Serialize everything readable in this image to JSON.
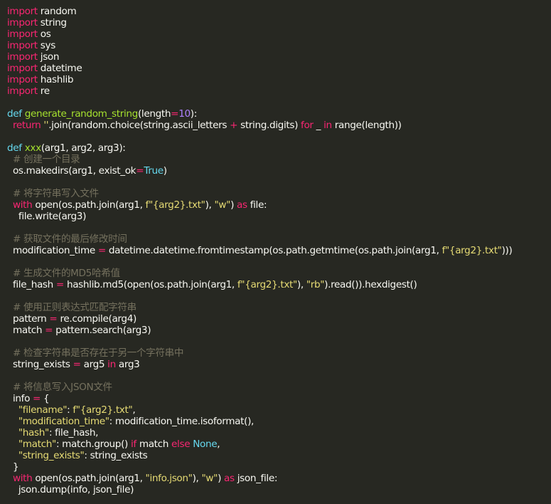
{
  "colors": {
    "background": "#272822",
    "text": "#f8f8f2",
    "keyword": "#f92672",
    "function": "#a6e22e",
    "number": "#ae81ff",
    "string": "#e6db74",
    "builtin": "#66d9ef",
    "comment": "#75715e"
  },
  "code_lines": [
    [
      [
        "kw",
        "import"
      ],
      [
        "pl",
        " random"
      ]
    ],
    [
      [
        "kw",
        "import"
      ],
      [
        "pl",
        " string"
      ]
    ],
    [
      [
        "kw",
        "import"
      ],
      [
        "pl",
        " os"
      ]
    ],
    [
      [
        "kw",
        "import"
      ],
      [
        "pl",
        " sys"
      ]
    ],
    [
      [
        "kw",
        "import"
      ],
      [
        "pl",
        " json"
      ]
    ],
    [
      [
        "kw",
        "import"
      ],
      [
        "pl",
        " datetime"
      ]
    ],
    [
      [
        "kw",
        "import"
      ],
      [
        "pl",
        " hashlib"
      ]
    ],
    [
      [
        "kw",
        "import"
      ],
      [
        "pl",
        " re"
      ]
    ],
    [],
    [
      [
        "bi",
        "def"
      ],
      [
        "pl",
        " "
      ],
      [
        "fn",
        "generate_random_string"
      ],
      [
        "pl",
        "(length"
      ],
      [
        "op",
        "="
      ],
      [
        "num",
        "10"
      ],
      [
        "pl",
        "):"
      ]
    ],
    [
      [
        "pl",
        "  "
      ],
      [
        "kw",
        "return"
      ],
      [
        "pl",
        " "
      ],
      [
        "str",
        "''"
      ],
      [
        "pl",
        ".join(random.choice(string.ascii_letters "
      ],
      [
        "op",
        "+"
      ],
      [
        "pl",
        " string.digits) "
      ],
      [
        "kw",
        "for"
      ],
      [
        "pl",
        " _ "
      ],
      [
        "kw",
        "in"
      ],
      [
        "pl",
        " range(length))"
      ]
    ],
    [],
    [
      [
        "bi",
        "def"
      ],
      [
        "pl",
        " "
      ],
      [
        "fn",
        "xxx"
      ],
      [
        "pl",
        "(arg1, arg2, arg3):"
      ]
    ],
    [
      [
        "pl",
        "  "
      ],
      [
        "cm",
        "# 创建一个目录"
      ]
    ],
    [
      [
        "pl",
        "  os.makedirs(arg1, exist_ok"
      ],
      [
        "op",
        "="
      ],
      [
        "bi",
        "True"
      ],
      [
        "pl",
        ")"
      ]
    ],
    [],
    [
      [
        "pl",
        "  "
      ],
      [
        "cm",
        "# 将字符串写入文件"
      ]
    ],
    [
      [
        "pl",
        "  "
      ],
      [
        "kw",
        "with"
      ],
      [
        "pl",
        " open(os.path.join(arg1, "
      ],
      [
        "str",
        "f\"{arg2}.txt\""
      ],
      [
        "pl",
        "), "
      ],
      [
        "str",
        "\"w\""
      ],
      [
        "pl",
        ") "
      ],
      [
        "kw",
        "as"
      ],
      [
        "pl",
        " file:"
      ]
    ],
    [
      [
        "pl",
        "    file.write(arg3)"
      ]
    ],
    [],
    [
      [
        "pl",
        "  "
      ],
      [
        "cm",
        "# 获取文件的最后修改时间"
      ]
    ],
    [
      [
        "pl",
        "  modification_time "
      ],
      [
        "op",
        "="
      ],
      [
        "pl",
        " datetime.datetime.fromtimestamp(os.path.getmtime(os.path.join(arg1, "
      ],
      [
        "str",
        "f\"{arg2}.txt\""
      ],
      [
        "pl",
        ")))"
      ]
    ],
    [],
    [
      [
        "pl",
        "  "
      ],
      [
        "cm",
        "# 生成文件的MD5哈希值"
      ]
    ],
    [
      [
        "pl",
        "  file_hash "
      ],
      [
        "op",
        "="
      ],
      [
        "pl",
        " hashlib.md5(open(os.path.join(arg1, "
      ],
      [
        "str",
        "f\"{arg2}.txt\""
      ],
      [
        "pl",
        "), "
      ],
      [
        "str",
        "\"rb\""
      ],
      [
        "pl",
        ").read()).hexdigest()"
      ]
    ],
    [],
    [
      [
        "pl",
        "  "
      ],
      [
        "cm",
        "# 使用正则表达式匹配字符串"
      ]
    ],
    [
      [
        "pl",
        "  pattern "
      ],
      [
        "op",
        "="
      ],
      [
        "pl",
        " re.compile(arg4)"
      ]
    ],
    [
      [
        "pl",
        "  match "
      ],
      [
        "op",
        "="
      ],
      [
        "pl",
        " pattern.search(arg3)"
      ]
    ],
    [],
    [
      [
        "pl",
        "  "
      ],
      [
        "cm",
        "# 检查字符串是否存在于另一个字符串中"
      ]
    ],
    [
      [
        "pl",
        "  string_exists "
      ],
      [
        "op",
        "="
      ],
      [
        "pl",
        " arg5 "
      ],
      [
        "kw",
        "in"
      ],
      [
        "pl",
        " arg3"
      ]
    ],
    [],
    [
      [
        "pl",
        "  "
      ],
      [
        "cm",
        "# 将信息写入JSON文件"
      ]
    ],
    [
      [
        "pl",
        "  info "
      ],
      [
        "op",
        "="
      ],
      [
        "pl",
        " {"
      ]
    ],
    [
      [
        "pl",
        "    "
      ],
      [
        "str",
        "\"filename\""
      ],
      [
        "pl",
        ": "
      ],
      [
        "str",
        "f\"{arg2}.txt\""
      ],
      [
        "pl",
        ","
      ]
    ],
    [
      [
        "pl",
        "    "
      ],
      [
        "str",
        "\"modification_time\""
      ],
      [
        "pl",
        ": modification_time.isoformat(),"
      ]
    ],
    [
      [
        "pl",
        "    "
      ],
      [
        "str",
        "\"hash\""
      ],
      [
        "pl",
        ": file_hash,"
      ]
    ],
    [
      [
        "pl",
        "    "
      ],
      [
        "str",
        "\"match\""
      ],
      [
        "pl",
        ": match.group() "
      ],
      [
        "kw",
        "if"
      ],
      [
        "pl",
        " match "
      ],
      [
        "kw",
        "else"
      ],
      [
        "pl",
        " "
      ],
      [
        "bi",
        "None"
      ],
      [
        "pl",
        ","
      ]
    ],
    [
      [
        "pl",
        "    "
      ],
      [
        "str",
        "\"string_exists\""
      ],
      [
        "pl",
        ": string_exists"
      ]
    ],
    [
      [
        "pl",
        "  }"
      ]
    ],
    [
      [
        "pl",
        "  "
      ],
      [
        "kw",
        "with"
      ],
      [
        "pl",
        " open(os.path.join(arg1, "
      ],
      [
        "str",
        "\"info.json\""
      ],
      [
        "pl",
        "), "
      ],
      [
        "str",
        "\"w\""
      ],
      [
        "pl",
        ") "
      ],
      [
        "kw",
        "as"
      ],
      [
        "pl",
        " json_file:"
      ]
    ],
    [
      [
        "pl",
        "    json.dump(info, json_file)"
      ]
    ]
  ]
}
